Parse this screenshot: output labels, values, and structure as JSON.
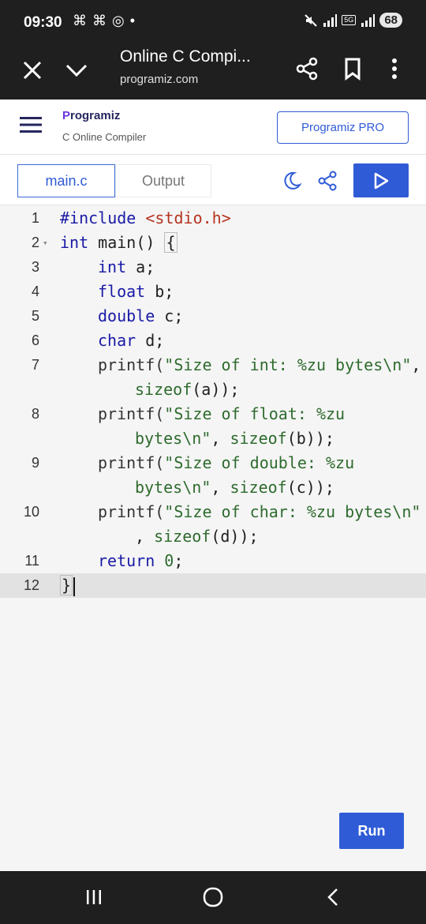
{
  "status_bar": {
    "time": "09:30",
    "left_icons": "⌘ ⌘ ◎ •",
    "net_tag": "5G",
    "battery": "68"
  },
  "tab_header": {
    "title": "Online C Compi...",
    "url": "programiz.com"
  },
  "site": {
    "logo_p": "P",
    "logo_rest": "rogramiz",
    "subtitle": "C Online Compiler",
    "pro_button": "Programiz PRO"
  },
  "toolbar": {
    "tab_main": "main.c",
    "tab_output": "Output"
  },
  "editor": {
    "line_numbers": [
      "1",
      "2",
      "3",
      "4",
      "5",
      "6",
      "7",
      "8",
      "9",
      "10",
      "11",
      "12"
    ],
    "active_line": 12
  },
  "run_button": "Run",
  "code": {
    "l1_kw": "#include",
    "l1_inc": "<stdio.h>",
    "l2_kw": "int",
    "l2_rest": " main() ",
    "l2_brace": "{",
    "l3_kw": "int",
    "l3_rest": " a;",
    "l4_kw": "float",
    "l4_rest": " b;",
    "l5_kw": "double",
    "l5_rest": " c;",
    "l6_kw": "char",
    "l6_rest": " d;",
    "l7_fn": "printf(",
    "l7_str": "\"Size of int: %zu bytes",
    "l7_esc": "\\n",
    "l7_str2": "\"",
    "l7_end": ",",
    "l7b_fn": "sizeof",
    "l7b_rest": "(a));",
    "l8_fn": "printf(",
    "l8_str": "\"Size of float: %zu",
    "l8b_str": "bytes",
    "l8b_esc": "\\n",
    "l8b_str2": "\"",
    "l8b_comma": ", ",
    "l8b_fn": "sizeof",
    "l8b_rest": "(b));",
    "l9_fn": "printf(",
    "l9_str": "\"Size of double: %zu",
    "l9b_str": "bytes",
    "l9b_esc": "\\n",
    "l9b_str2": "\"",
    "l9b_comma": ", ",
    "l9b_fn": "sizeof",
    "l9b_rest": "(c));",
    "l10_fn": "printf(",
    "l10_str": "\"Size of char: %zu bytes",
    "l10_esc": "\\n",
    "l10_str2": "\"",
    "l10b_comma": ", ",
    "l10b_fn": "sizeof",
    "l10b_rest": "(d));",
    "l11_kw": "return",
    "l11_num": " 0",
    "l11_rest": ";",
    "l12_brace": "}"
  },
  "icons": {
    "close": "close-icon",
    "chevron": "chevron-down-icon",
    "share": "share-icon",
    "bookmark": "bookmark-icon",
    "more": "more-vert-icon",
    "menu": "hamburger-icon",
    "moon": "moon-icon",
    "play": "play-icon"
  }
}
